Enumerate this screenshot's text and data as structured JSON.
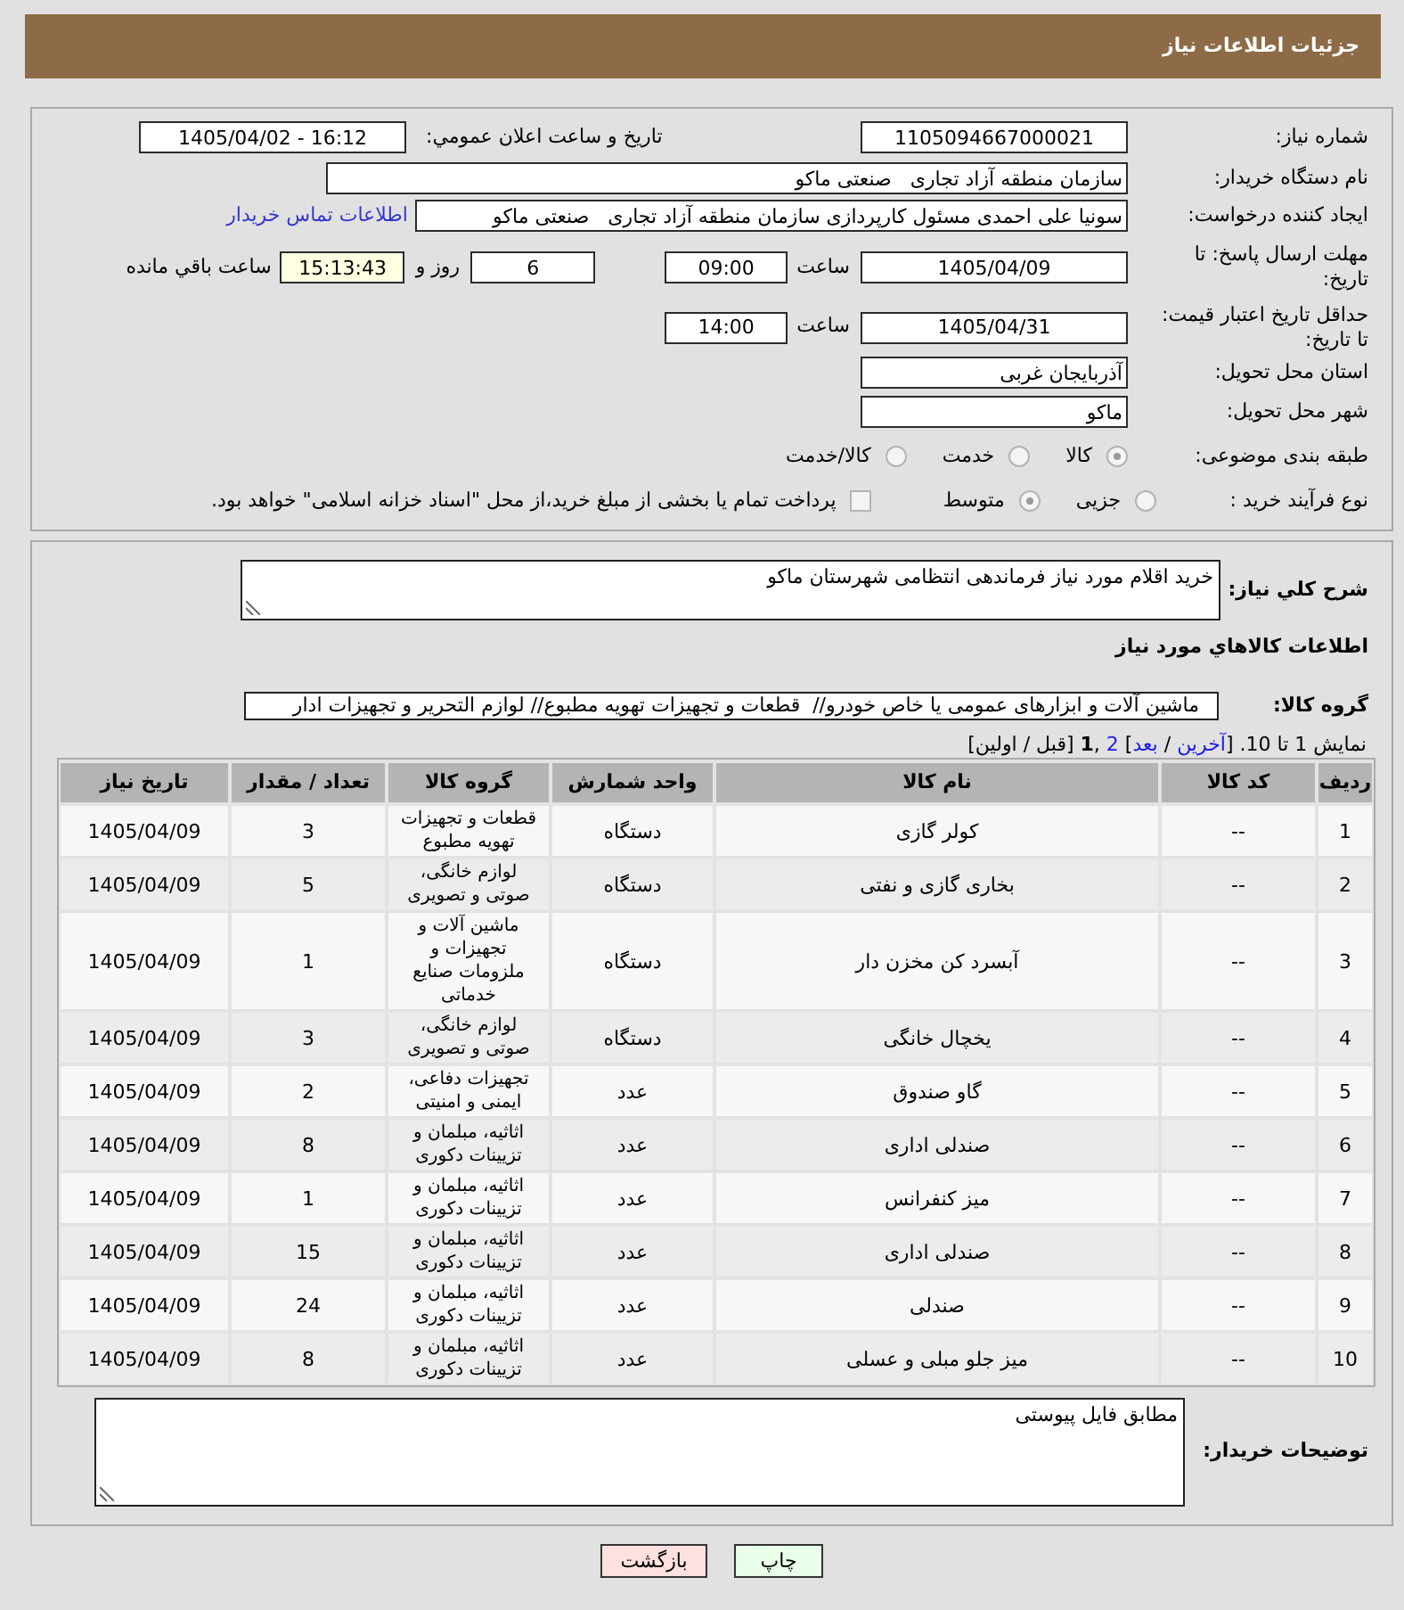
{
  "header": {
    "title": "جزئیات اطلاعات نیاز"
  },
  "details": {
    "need_number": {
      "label": "شماره نیاز:",
      "value": "1105094667000021"
    },
    "announce_date": {
      "label": "تاریخ و ساعت اعلان عمومي:",
      "value": "1405/04/02 - 16:12"
    },
    "buyer_org": {
      "label": "نام دستگاه خریدار:",
      "value": "سازمان منطقه آزاد تجاری   صنعتی ماکو"
    },
    "requester": {
      "label": "ایجاد کننده درخواست:",
      "value": "سونیا علی احمدی مسئول کارپردازی سازمان منطقه آزاد تجاری   صنعتی ماکو",
      "contact_link": "اطلاعات تماس خریدار"
    },
    "reply_deadline": {
      "label": "مهلت ارسال پاسخ: تا تاریخ:",
      "date": "1405/04/09",
      "time_label": "ساعت",
      "time": "09:00",
      "days": "6",
      "days_label": "روز و",
      "remaining": "15:13:43",
      "remaining_label": "ساعت باقي مانده"
    },
    "price_validity": {
      "label": "حداقل تاریخ اعتبار قیمت: تا تاریخ:",
      "date": "1405/04/31",
      "time_label": "ساعت",
      "time": "14:00"
    },
    "province": {
      "label": "استان محل تحویل:",
      "value": "آذربایجان غربی"
    },
    "city": {
      "label": "شهر محل تحویل:",
      "value": "ماکو"
    },
    "category": {
      "label": "طبقه بندی موضوعی:",
      "options": [
        {
          "label": "کالا",
          "selected": true
        },
        {
          "label": "خدمت",
          "selected": false
        },
        {
          "label": "کالا/خدمت",
          "selected": false
        }
      ]
    },
    "process": {
      "label": "نوع فرآیند خرید :",
      "options": [
        {
          "label": "جزیی",
          "selected": false
        },
        {
          "label": "متوسط",
          "selected": true
        }
      ],
      "treasury": {
        "label": "پرداخت تمام یا بخشی از مبلغ خرید،از محل \"اسناد خزانه اسلامی\" خواهد بود.",
        "checked": false
      }
    }
  },
  "summary": {
    "label": "شرح کلي نیاز:",
    "value": "خرید اقلام مورد نیاز فرماندهی انتظامی شهرستان ماکو"
  },
  "goods": {
    "title": "اطلاعات کالاهاي مورد نیاز",
    "group_label": "گروه کالا:",
    "group_value": "ماشین آلات و ابزارهای عمومی یا خاص خودرو//  قطعات و تجهیزات تهویه مطبوع// لوازم التحریر و تجهیزات ادار",
    "pager": [
      {
        "kind": "text",
        "text": "نمایش 1 تا 10. ["
      },
      {
        "kind": "link",
        "text": "آخرین"
      },
      {
        "kind": "text",
        "text": " / "
      },
      {
        "kind": "link",
        "text": "بعد"
      },
      {
        "kind": "text",
        "text": "] "
      },
      {
        "kind": "link",
        "text": "2"
      },
      {
        "kind": "text",
        "text": " ,"
      },
      {
        "kind": "current",
        "text": "1"
      },
      {
        "kind": "text",
        "text": " [قبل / اولین]"
      }
    ],
    "table": {
      "columns": [
        "ردیف",
        "کد کالا",
        "نام کالا",
        "واحد شمارش",
        "گروه کالا",
        "تعداد / مقدار",
        "تاریخ نیاز"
      ],
      "rows": [
        [
          "1",
          "--",
          "کولر گازی",
          "دستگاه",
          "قطعات و تجهیزات تهویه مطبوع",
          "3",
          "1405/04/09"
        ],
        [
          "2",
          "--",
          "بخاری گازی و نفتی",
          "دستگاه",
          "لوازم خانگی، صوتی و تصویری",
          "5",
          "1405/04/09"
        ],
        [
          "3",
          "--",
          "آبسرد کن مخزن دار",
          "دستگاه",
          "ماشین آلات و تجهیزات و ملزومات صنایع خدماتی",
          "1",
          "1405/04/09"
        ],
        [
          "4",
          "--",
          "یخچال خانگی",
          "دستگاه",
          "لوازم خانگی، صوتی و تصویری",
          "3",
          "1405/04/09"
        ],
        [
          "5",
          "--",
          "گاو صندوق",
          "عدد",
          "تجهیزات دفاعی، ایمنی و امنیتی",
          "2",
          "1405/04/09"
        ],
        [
          "6",
          "--",
          "صندلی اداری",
          "عدد",
          "اثاثیه، مبلمان و تزیینات دکوری",
          "8",
          "1405/04/09"
        ],
        [
          "7",
          "--",
          "میز کنفرانس",
          "عدد",
          "اثاثیه، مبلمان و تزیینات دکوری",
          "1",
          "1405/04/09"
        ],
        [
          "8",
          "--",
          "صندلی اداری",
          "عدد",
          "اثاثیه، مبلمان و تزیینات دکوری",
          "15",
          "1405/04/09"
        ],
        [
          "9",
          "--",
          "صندلی",
          "عدد",
          "اثاثیه، مبلمان و تزیینات دکوری",
          "24",
          "1405/04/09"
        ],
        [
          "10",
          "--",
          "میز جلو مبلی و عسلی",
          "عدد",
          "اثاثیه، مبلمان و تزیینات دکوری",
          "8",
          "1405/04/09"
        ]
      ]
    }
  },
  "buyer_notes": {
    "label": "توضیحات خریدار:",
    "value": "مطابق فایل پیوستی"
  },
  "buttons": [
    {
      "label": "چاپ",
      "kind": "print"
    },
    {
      "label": "بازگشت",
      "kind": "back"
    }
  ]
}
